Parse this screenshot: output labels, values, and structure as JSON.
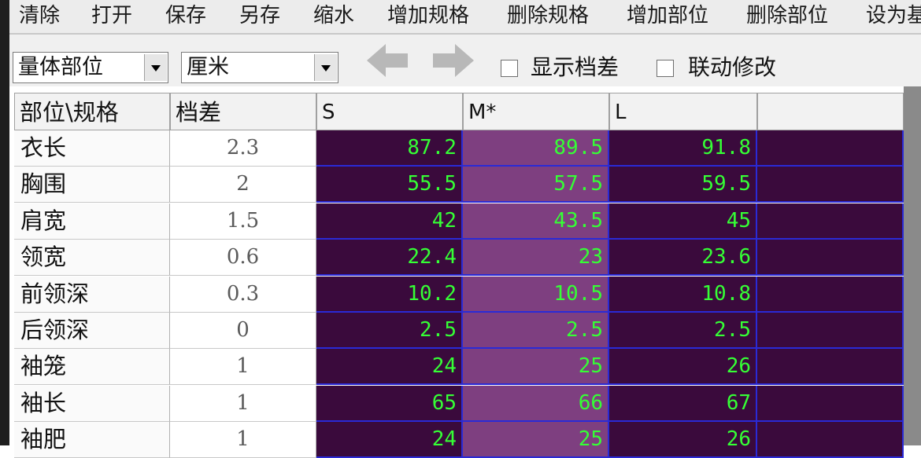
{
  "menu": {
    "items": [
      "清除",
      "打开",
      "保存",
      "另存",
      "缩水",
      "增加规格",
      "删除规格",
      "增加部位",
      "删除部位",
      "设为基"
    ]
  },
  "toolbar": {
    "part_type": "量体部位",
    "unit": "厘米",
    "show_diff_label": "显示档差",
    "linked_edit_label": "联动修改"
  },
  "table": {
    "headers": {
      "part": "部位\\规格",
      "diff": "档差",
      "sizes": [
        "S",
        "M*",
        "L",
        ""
      ]
    },
    "rows": [
      {
        "part": "衣长",
        "diff": "2.3",
        "s": "87.2",
        "m": "89.5",
        "l": "91.8"
      },
      {
        "part": "胸围",
        "diff": "2",
        "s": "55.5",
        "m": "57.5",
        "l": "59.5"
      },
      {
        "part": "肩宽",
        "diff": "1.5",
        "s": "42",
        "m": "43.5",
        "l": "45"
      },
      {
        "part": "领宽",
        "diff": "0.6",
        "s": "22.4",
        "m": "23",
        "l": "23.6"
      },
      {
        "part": "前领深",
        "diff": "0.3",
        "s": "10.2",
        "m": "10.5",
        "l": "10.8"
      },
      {
        "part": "后领深",
        "diff": "0",
        "s": "2.5",
        "m": "2.5",
        "l": "2.5"
      },
      {
        "part": "袖笼",
        "diff": "1",
        "s": "24",
        "m": "25",
        "l": "26"
      },
      {
        "part": "袖长",
        "diff": "1",
        "s": "65",
        "m": "66",
        "l": "67"
      },
      {
        "part": "袖肥",
        "diff": "1",
        "s": "24",
        "m": "25",
        "l": "26"
      }
    ]
  }
}
